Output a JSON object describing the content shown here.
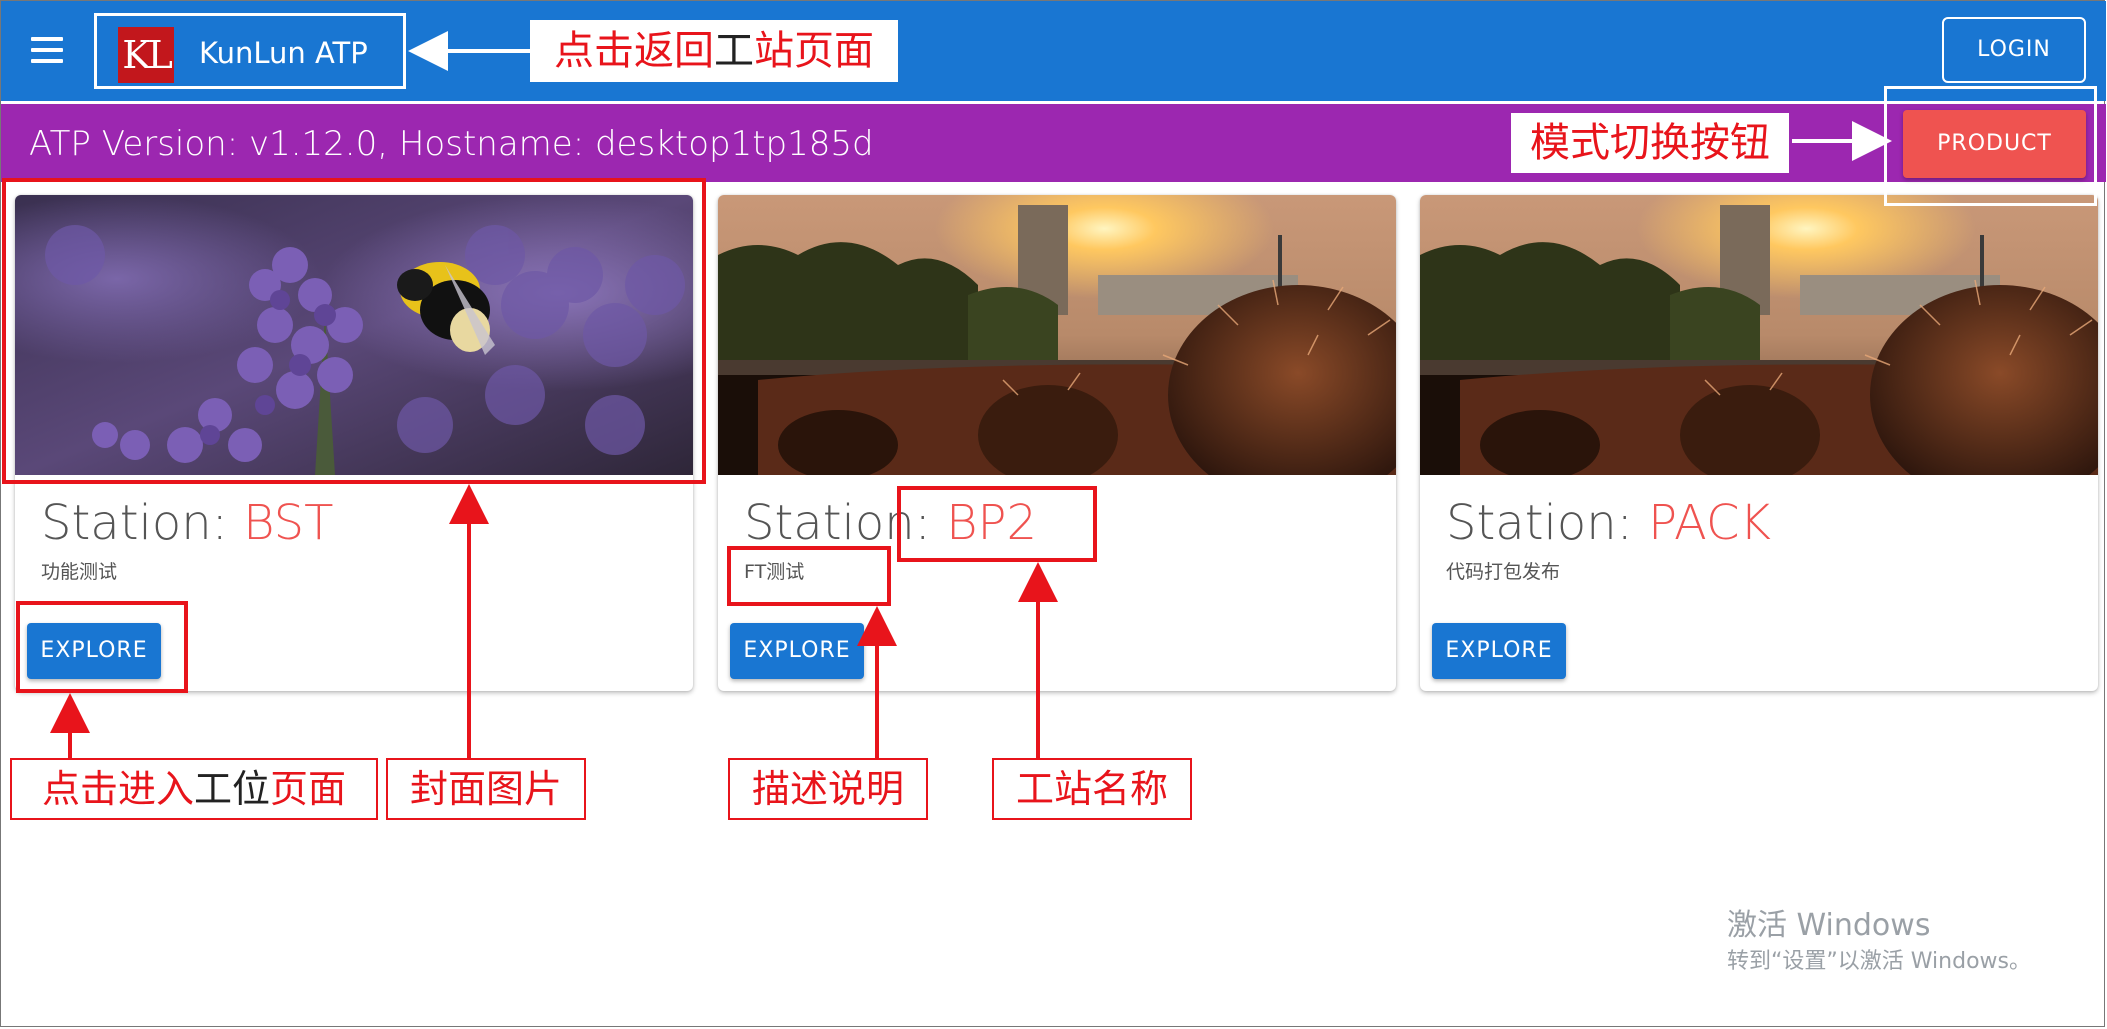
{
  "appbar": {
    "logo_text": "KL",
    "title": "KunLun ATP",
    "login_label": "LOGIN",
    "menu_icon": "menu-icon",
    "color": "#1976d2"
  },
  "versionbar": {
    "text": "ATP Version: v1.12.0, Hostname: desktop1tp185d",
    "mode_button_label": "PRODUCT",
    "color": "#9c27b0",
    "button_color": "#ef5350"
  },
  "cards": [
    {
      "title_prefix": "Station: ",
      "station_name": "BST",
      "description": "功能测试",
      "button_label": "EXPLORE",
      "image": "lavender-bee-photo"
    },
    {
      "title_prefix": "Station: ",
      "station_name": "BP2",
      "description": "FT测试",
      "button_label": "EXPLORE",
      "image": "cactus-sunset-photo"
    },
    {
      "title_prefix": "Station: ",
      "station_name": "PACK",
      "description": "代码打包发布",
      "button_label": "EXPLORE",
      "image": "cactus-sunset-photo"
    }
  ],
  "annotations": {
    "home": [
      "点击返回",
      "工",
      "站",
      "页面"
    ],
    "mode_switch": "模式切换按钮",
    "enter": [
      "点击进入",
      "工位",
      "页面"
    ],
    "cover": "封面图片",
    "description": "描述说明",
    "station_name": "工站名称",
    "color": "#e8141b"
  },
  "watermark": {
    "line1": "激活 Windows",
    "line2": "转到“设置”以激活 Windows。"
  }
}
